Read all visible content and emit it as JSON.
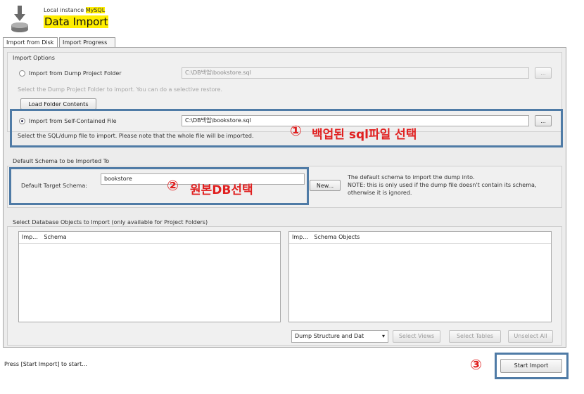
{
  "header": {
    "subtitle_prefix": "Local instance ",
    "subtitle_highlight": "MySQL",
    "title": "Data Import",
    "icon": "database-import-icon"
  },
  "tabs": [
    {
      "label": "Import from Disk",
      "active": true
    },
    {
      "label": "Import Progress",
      "active": false
    }
  ],
  "import_options": {
    "group_label": "Import Options",
    "dump_folder": {
      "label": "Import from Dump Project Folder",
      "path": "C:\\DB백업\\bookstore.sql",
      "hint": "Select the Dump Project Folder to import. You can do a selective restore.",
      "load_button": "Load Folder Contents",
      "browse": "...",
      "selected": false
    },
    "self_contained": {
      "label": "Import from Self-Contained File",
      "path": "C:\\DB백업\\bookstore.sql",
      "hint": "Select the SQL/dump file to import. Please note that the whole file will be imported.",
      "browse": "...",
      "selected": true
    }
  },
  "schema": {
    "group_label": "Default Schema to be Imported To",
    "target_label": "Default Target Schema:",
    "target_value": "bookstore",
    "new_button": "New...",
    "note_line1": "The default schema to import the dump into.",
    "note_line2": "NOTE: this is only used if the dump file doesn't contain its schema,",
    "note_line3": "otherwise it is ignored."
  },
  "objects": {
    "group_label": "Select Database Objects to Import (only available for Project Folders)",
    "left_list": {
      "col1": "Imp...",
      "col2": "Schema"
    },
    "right_list": {
      "col1": "Imp...",
      "col2": "Schema Objects"
    },
    "dump_select": "Dump Structure and Dat",
    "select_views": "Select Views",
    "select_tables": "Select Tables",
    "unselect_all": "Unselect All"
  },
  "footer": {
    "status": "Press [Start Import] to start...",
    "start_button": "Start Import"
  },
  "annotations": {
    "one_num": "①",
    "one_text": "백업된 sql파일 선택",
    "two_num": "②",
    "two_text": "원본DB선택",
    "three_num": "③"
  },
  "colors": {
    "annotation_border": "#4f7ba6",
    "annotation_text": "#e02020",
    "highlight": "#ffee00"
  }
}
